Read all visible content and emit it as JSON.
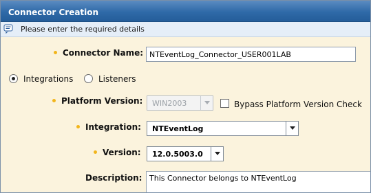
{
  "window": {
    "title": "Connector Creation"
  },
  "info": {
    "message": "Please enter the required details",
    "icon": "message-icon"
  },
  "form": {
    "connector_name": {
      "label": "Connector Name:",
      "value": "NTEventLog_Connector_USER001LAB"
    },
    "mode": {
      "options": [
        {
          "label": "Integrations",
          "checked": true
        },
        {
          "label": "Listeners",
          "checked": false
        }
      ]
    },
    "platform_version": {
      "label": "Platform Version:",
      "value": "WIN2003",
      "disabled": true
    },
    "bypass_check": {
      "label": "Bypass Platform Version Check",
      "checked": false
    },
    "integration": {
      "label": "Integration:",
      "value": "NTEventLog"
    },
    "version": {
      "label": "Version:",
      "value": "12.0.5003.0"
    },
    "description": {
      "label": "Description:",
      "value": "This Connector belongs to NTEventLog"
    }
  },
  "colors": {
    "titlebar": "#2f6aa8",
    "form_background": "#fbf3dd",
    "required_marker": "#f2b51b",
    "infobar": "#e5eef8"
  }
}
